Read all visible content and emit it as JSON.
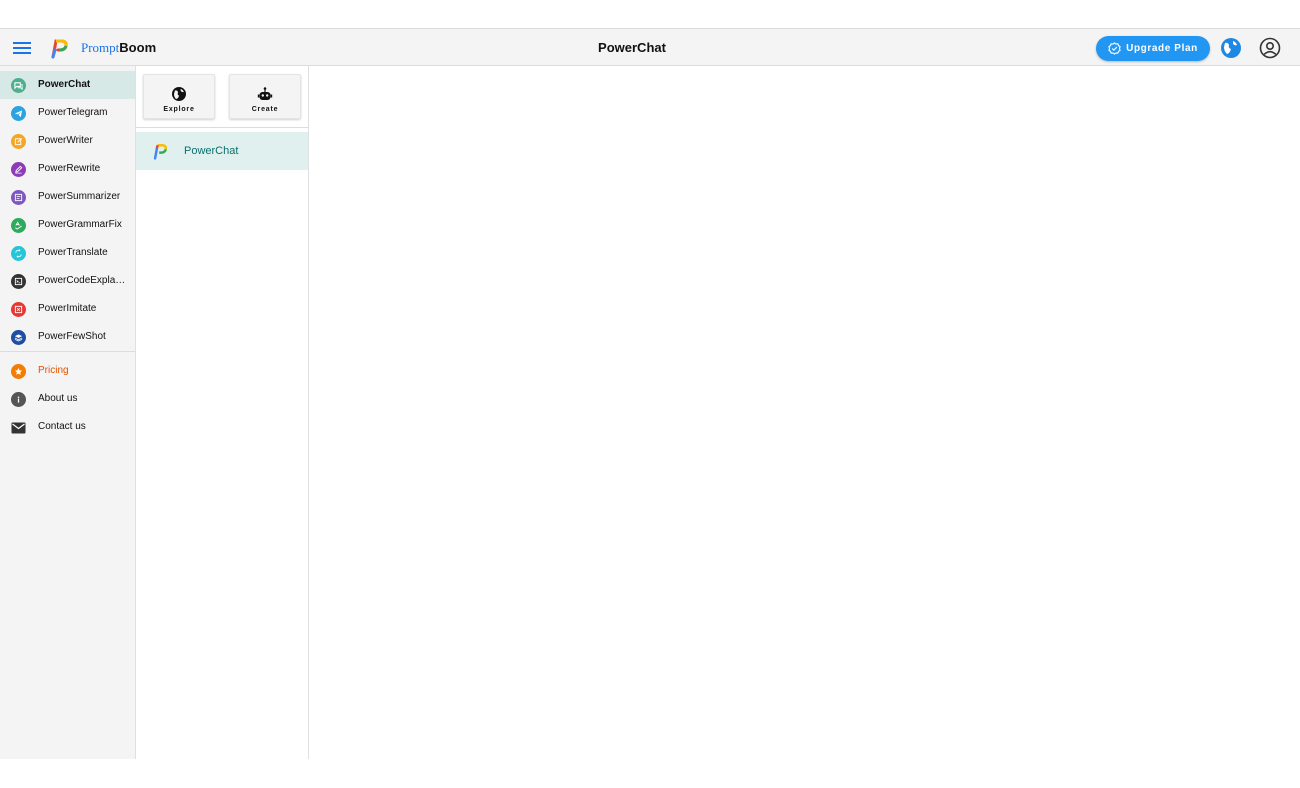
{
  "header": {
    "menu_icon": "menu-icon",
    "brand_part1": "Prompt",
    "brand_part2": "Boom",
    "title": "PowerChat",
    "upgrade_label": "Upgrade Plan",
    "upgrade_icon": "verified-badge-icon",
    "language_icon": "globe-icon",
    "account_icon": "account-circle-icon",
    "upgrade_color": "#2196f3"
  },
  "sidebar": {
    "items": [
      {
        "label": "PowerChat",
        "icon": "chat-icon",
        "color": "#4caf8e",
        "active": true
      },
      {
        "label": "PowerTelegram",
        "icon": "telegram-icon",
        "color": "#2aa3e0"
      },
      {
        "label": "PowerWriter",
        "icon": "edit-note-icon",
        "color": "#f5a623"
      },
      {
        "label": "PowerRewrite",
        "icon": "pen-icon",
        "color": "#8e3bb8"
      },
      {
        "label": "PowerSummarizer",
        "icon": "summary-icon",
        "color": "#7e57c2"
      },
      {
        "label": "PowerGrammarFix",
        "icon": "spellcheck-icon",
        "color": "#2eaa5c"
      },
      {
        "label": "PowerTranslate",
        "icon": "translate-icon",
        "color": "#26c6da"
      },
      {
        "label": "PowerCodeExpla…",
        "icon": "terminal-icon",
        "color": "#333333"
      },
      {
        "label": "PowerImitate",
        "icon": "imitate-icon",
        "color": "#e53935"
      },
      {
        "label": "PowerFewShot",
        "icon": "layers-icon",
        "color": "#1e4fa3"
      }
    ],
    "footer": [
      {
        "label": "Pricing",
        "icon": "star-icon",
        "color": "#f57c00"
      },
      {
        "label": "About us",
        "icon": "info-icon",
        "color": "#555555"
      },
      {
        "label": "Contact us",
        "icon": "mail-icon",
        "color": "#333333"
      }
    ]
  },
  "panel": {
    "explore_label": "Explore",
    "explore_icon": "globe-icon",
    "create_label": "Create",
    "create_icon": "robot-icon",
    "bots": [
      {
        "label": "PowerChat",
        "icon": "promptboom-logo",
        "active": true
      }
    ]
  }
}
